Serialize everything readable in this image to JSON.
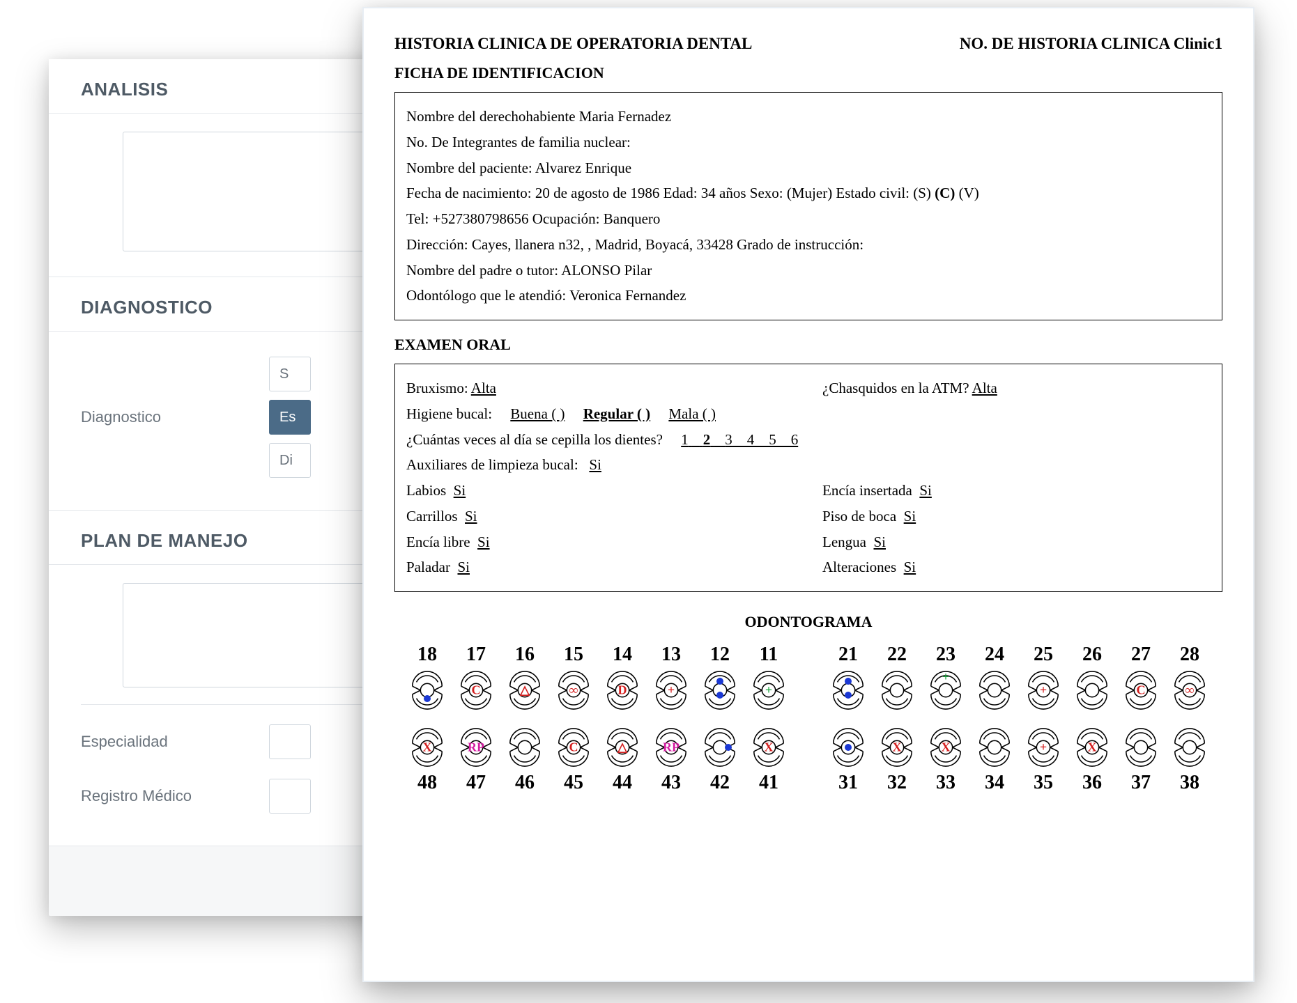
{
  "back": {
    "analisis_header": "ANALISIS",
    "diagnostico_header": "DIAGNOSTICO",
    "diagnostico_label": "Diagnostico",
    "diag_option_1": "S",
    "diag_option_2": "Es",
    "diag_option_3": "Di",
    "plan_header": "PLAN DE MANEJO",
    "especialidad_label": "Especialidad",
    "registro_label": "Registro Médico"
  },
  "doc": {
    "title": "HISTORIA CLINICA DE OPERATORIA DENTAL",
    "clinic_no_label": "NO. DE HISTORIA CLINICA",
    "clinic_no_value": "Clinic1",
    "ficha_title": "FICHA DE IDENTIFICACION",
    "ficha": {
      "l1": "Nombre del derechohabiente Maria Fernadez",
      "l2": "No. De Integrantes de familia nuclear:",
      "l3": "Nombre del paciente: Alvarez Enrique",
      "l4_pre": "Fecha de nacimiento: 20 de agosto de 1986 Edad: 34 años Sexo: (Mujer) Estado civil: (S) ",
      "l4_bold": "(C)",
      "l4_post": " (V)",
      "l5": "Tel: +527380798656 Ocupación: Banquero",
      "l6": "Dirección: Cayes, llanera n32, , Madrid, Boyacá, 33428 Grado de instrucción:",
      "l7": "Nombre del padre o tutor: ALONSO Pilar",
      "l8": "Odontólogo que le atendió: Veronica Fernandez"
    },
    "exam_title": "EXAMEN ORAL",
    "exam_left": {
      "bruxismo_label": "Bruxismo:",
      "bruxismo_val": "Alta",
      "higiene_label": "Higiene bucal:",
      "higiene_buena": "Buena ( )",
      "higiene_regular": "Regular ( )",
      "higiene_mala": "Mala ( )",
      "cepilla_label": "¿Cuántas veces al día se cepilla los dientes?",
      "cepilla_nums_pre": "1",
      "cepilla_nums_bold": "2",
      "cepilla_nums_post": "3    4    5    6",
      "aux_label": "Auxiliares de limpieza bucal:",
      "aux_val": "Si",
      "labios_label": "Labios",
      "labios_val": "Si",
      "carrillos_label": "Carrillos",
      "carrillos_val": "Si",
      "encia_libre_label": "Encía libre",
      "encia_libre_val": "Si",
      "paladar_label": "Paladar",
      "paladar_val": "Si"
    },
    "exam_right": {
      "chasquidos_label": "¿Chasquidos en la ATM?",
      "chasquidos_val": "Alta",
      "encia_ins_label": "Encía insertada",
      "encia_ins_val": "Si",
      "piso_label": "Piso de boca",
      "piso_val": "Si",
      "lengua_label": "Lengua",
      "lengua_val": "Si",
      "alter_label": "Alteraciones",
      "alter_val": "Si"
    },
    "odonto_title": "ODONTOGRAMA",
    "odonto": {
      "top_left": [
        "18",
        "17",
        "16",
        "15",
        "14",
        "13",
        "12",
        "11"
      ],
      "top_right": [
        "21",
        "22",
        "23",
        "24",
        "25",
        "26",
        "27",
        "28"
      ],
      "bot_left": [
        "48",
        "47",
        "46",
        "45",
        "44",
        "43",
        "42",
        "41"
      ],
      "bot_right": [
        "31",
        "32",
        "33",
        "34",
        "35",
        "36",
        "37",
        "38"
      ],
      "marks_top_left": [
        {
          "type": "dot",
          "color": "blue",
          "pos": "bottom"
        },
        {
          "type": "text",
          "text": "C",
          "color": "red"
        },
        {
          "type": "text",
          "text": "△",
          "color": "red"
        },
        {
          "type": "text",
          "text": "∞",
          "color": "red"
        },
        {
          "type": "text",
          "text": "D",
          "color": "red"
        },
        {
          "type": "text",
          "text": "+",
          "color": "red"
        },
        {
          "type": "dots2",
          "color": "blue"
        },
        {
          "type": "text",
          "text": "+",
          "color": "green"
        }
      ],
      "marks_top_right": [
        {
          "type": "dots2",
          "color": "blue"
        },
        {
          "type": "none"
        },
        {
          "type": "text",
          "text": "+",
          "color": "green",
          "pos": "top"
        },
        {
          "type": "none"
        },
        {
          "type": "text",
          "text": "+",
          "color": "red"
        },
        {
          "type": "none"
        },
        {
          "type": "text",
          "text": "C",
          "color": "red"
        },
        {
          "type": "text",
          "text": "∞",
          "color": "red"
        }
      ],
      "marks_bot_left": [
        {
          "type": "text",
          "text": "X",
          "color": "red"
        },
        {
          "type": "text",
          "text": "RP",
          "color": "magenta"
        },
        {
          "type": "none"
        },
        {
          "type": "text",
          "text": "C",
          "color": "red"
        },
        {
          "type": "text",
          "text": "△",
          "color": "red"
        },
        {
          "type": "text",
          "text": "RP",
          "color": "magenta"
        },
        {
          "type": "dot",
          "color": "blue",
          "pos": "right"
        },
        {
          "type": "text",
          "text": "X",
          "color": "red"
        }
      ],
      "marks_bot_right": [
        {
          "type": "dot",
          "color": "blue",
          "pos": "center"
        },
        {
          "type": "text",
          "text": "X",
          "color": "red"
        },
        {
          "type": "text",
          "text": "X",
          "color": "red"
        },
        {
          "type": "none"
        },
        {
          "type": "text",
          "text": "+",
          "color": "red"
        },
        {
          "type": "text",
          "text": "X",
          "color": "red"
        },
        {
          "type": "none"
        },
        {
          "type": "none"
        }
      ]
    }
  }
}
